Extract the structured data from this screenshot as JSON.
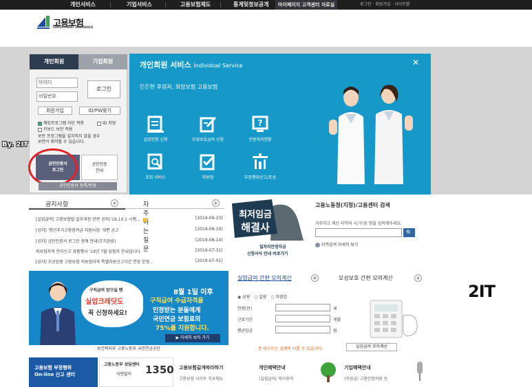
{
  "top_nav": {
    "items": [
      "개인서비스",
      "기업서비스",
      "고용보험제도",
      "통계및정보공개"
    ],
    "active_group": "마이페이지  고객센터  자료실",
    "util": "로그인 · 회원가입 · 사이트맵"
  },
  "logo": {
    "name": "고용보험",
    "eng": "EMPLOYMENT INSURANCE"
  },
  "login": {
    "tab_person": "개인회원",
    "tab_company": "기업회원",
    "id_placeholder": "아이디",
    "pw_placeholder": "비밀번호",
    "login_button": "로그인",
    "join_button": "회원가입",
    "find_button": "ID/PW찾기",
    "chk_security": "해킹프로그램 차단 적용",
    "chk_saveid": "ID 저장",
    "chk_keyboard": "키보드 보안 적용",
    "notice_line1": "보안 프로그램을 설치하지 않을 경우",
    "notice_line2": "보안이 취약할 수 있습니다.",
    "cert_login_line1": "공인인증서",
    "cert_login_line2": "로그인",
    "cert_guide_line1": "공인인증",
    "cert_guide_line2": "안내",
    "cert_register": "공인인증서 등록/변경"
  },
  "watermarks": {
    "by": "By. 2IT",
    "big": "2IT"
  },
  "service_panel": {
    "title": "개인회원 서비스",
    "title_en": "Individual Service",
    "close": "✕",
    "tagline": "든든한 후원자, 희망보험 고용보험",
    "services": [
      {
        "label": "실업인정 신청",
        "icon": "unemployment-icon"
      },
      {
        "label": "모성보호급여 신청",
        "icon": "maternity-icon"
      },
      {
        "label": "민원처리현황",
        "icon": "question-icon"
      },
      {
        "label": "조회 서비스",
        "icon": "lookup-icon"
      },
      {
        "label": "피보험",
        "icon": "insured-icon"
      },
      {
        "label": "부정행위신고/포상",
        "icon": "report-icon"
      }
    ]
  },
  "notice": {
    "tab_notice": "공지사항",
    "tab_faq": "자주하는 질문",
    "items": [
      {
        "text": "[실업급여] 고용보험법 일부개정 관련 공지('19.10.1 시행...",
        "date": "[2019-09-23]",
        "new": "N"
      },
      {
        "text": "[공지] '청년추가고용장려금 지원사업' 개편 공고",
        "date": "[2019-08-19]"
      },
      {
        "text": "[공지] 공인인증서 로그인 장애 안내(조치완료)",
        "date": "[2019-08-14]"
      },
      {
        "text": "피보험자격 전자신고 경품행사 '19년 7월 당첨자 안내입니다.",
        "date": "[2019-07-31]"
      },
      {
        "text": "[공지] 조선업종 고용보험 피보험자격 특별지원신고기간 연장 운영...",
        "date": "[2019-07-01]"
      }
    ]
  },
  "wage_banner": {
    "line1": "최저임금",
    "line2": "해결사",
    "line3": "일자리안정자금",
    "line4": "신청서식 안내 바로가기"
  },
  "office_search": {
    "title": "고용노동청(지청)/고용센터 검색",
    "desc": "거주하고 계신 지역의 시/구/동 명을 입력해주세요.",
    "go": "🔍",
    "more": "지역검색 자세히 보기"
  },
  "big_banner": {
    "bubble1": "구직급여 받으실 땐",
    "bubble2": "실업크레딧도",
    "bubble3": "꼭 신청하세요!",
    "headline": "8월 1일 이후",
    "line1": "구직급여 수급자격을",
    "line2": "인정받는 분들에게",
    "line3": "국민연금 보험료의",
    "line4": "75%를 지원합니다.",
    "cta": "▶ 자세히 보러 가기",
    "footer": "보건복지부   고용노동부   국민연금공단"
  },
  "calc": {
    "tab1": "실업급여 간편 모의계산",
    "tab2": "모성보호 간편 모의계산",
    "radio_labels": [
      "상용",
      "일용",
      "자영업"
    ],
    "fields": [
      {
        "label": "연령(만)",
        "unit": "세"
      },
      {
        "label": "근로기간",
        "unit": "개월"
      },
      {
        "label": "평균임금",
        "unit": "원"
      }
    ],
    "note": "본 테스트는 실제와 다를 수 있습니다.",
    "button": "실업급여 모의계산"
  },
  "footer_row": {
    "box1_line1": "고용보험 부정행위",
    "box1_line2": "On-line 신고 센터",
    "box2_title": "고용노동부 상담센터",
    "box2_number": "1350",
    "box2_sub": "국번없이",
    "box3_title": "고용보험길게따라하기",
    "box3_sub": "고용보험 사이트 주요메뉴",
    "box4_title": "개인혜택안내",
    "box4_sub": "(실업급여/ 육아휴직",
    "box5_title": "기업혜택안내",
    "box5_sub": "(지원금/ 고용안정지원 등"
  }
}
